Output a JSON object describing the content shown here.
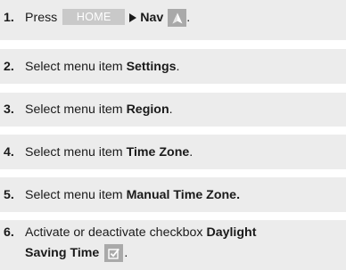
{
  "steps": [
    {
      "number": "1.",
      "text_a": "Press",
      "home_button": "HOME",
      "nav_label": "Nav",
      "icon": "navigation-arrow-icon",
      "suffix": "."
    },
    {
      "number": "2.",
      "text": "Select menu item ",
      "bold": "Settings",
      "suffix": "."
    },
    {
      "number": "3.",
      "text": "Select menu item ",
      "bold": "Region",
      "suffix": "."
    },
    {
      "number": "4.",
      "text": "Select menu item ",
      "bold": "Time Zone",
      "suffix": "."
    },
    {
      "number": "5.",
      "text": "Select menu item ",
      "bold": "Manual Time Zone.",
      "suffix": ""
    },
    {
      "number": "6.",
      "text": "Activate or deactivate checkbox ",
      "bold_line1": "Daylight",
      "bold_line2": "Saving Time",
      "icon": "checkbox-checked-icon",
      "suffix": "."
    }
  ],
  "colors": {
    "step_background": "#ececec",
    "home_button_bg": "#c9c9c9",
    "icon_bg": "#a9a9a9",
    "text": "#1a1a1a"
  }
}
